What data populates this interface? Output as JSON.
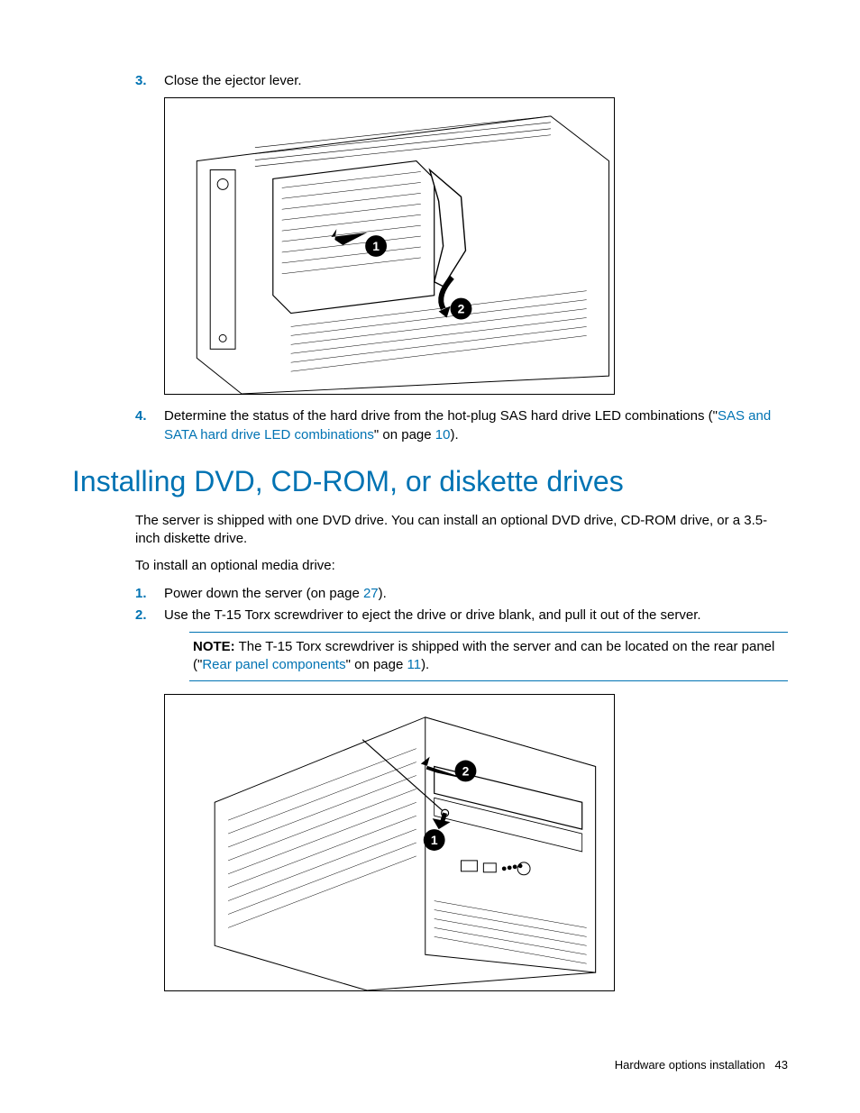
{
  "steps_top": [
    {
      "num": "3.",
      "text": "Close the ejector lever."
    },
    {
      "num": "4.",
      "prefix": "Determine the status of the hard drive from the hot-plug SAS hard drive LED combinations (\"",
      "link": "SAS and SATA hard drive LED combinations",
      "mid": "\" on page ",
      "page": "10",
      "suffix": ")."
    }
  ],
  "section_heading": "Installing DVD, CD-ROM, or diskette drives",
  "intro_para": "The server is shipped with one DVD drive. You can install an optional DVD drive, CD-ROM drive, or a 3.5-inch diskette drive.",
  "lead_in": "To install an optional media drive:",
  "steps_bottom": [
    {
      "num": "1.",
      "prefix": "Power down the server (on page ",
      "page": "27",
      "suffix": ")."
    },
    {
      "num": "2.",
      "text": "Use the T-15 Torx screwdriver to eject the drive or drive blank, and pull it out of the server."
    }
  ],
  "note": {
    "label": "NOTE:",
    "prefix": "  The T-15 Torx screwdriver is shipped with the server and can be located on the rear panel (\"",
    "link": "Rear panel components",
    "mid": "\" on page ",
    "page": "11",
    "suffix": ")."
  },
  "figures": {
    "fig1_alt": "Server front view — close ejector lever, callouts 1 and 2",
    "fig2_alt": "Server front view — eject media drive with T-15, callouts 1 and 2"
  },
  "footer": {
    "title": "Hardware options installation",
    "page": "43"
  }
}
